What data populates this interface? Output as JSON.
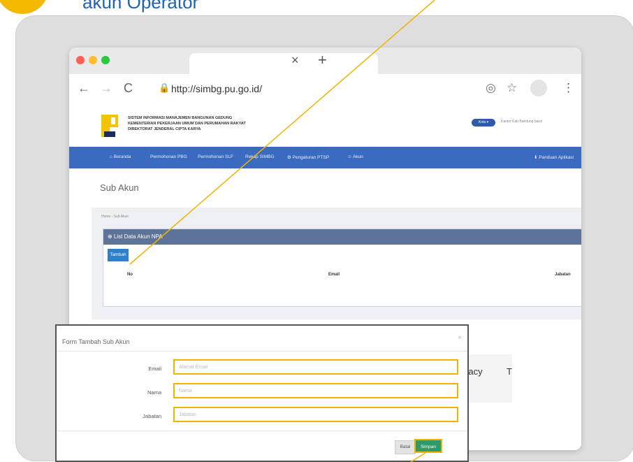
{
  "step": {
    "title": "akun Operator"
  },
  "browser": {
    "tab_close": "×",
    "new_tab": "+",
    "url": "http://simbg.pu.go.id/",
    "back_icon": "←",
    "forward_icon": "→",
    "reload_icon": "C",
    "lock_icon": "🔒",
    "menu_icon": "⋮",
    "star_icon": "☆",
    "location_icon": "◎"
  },
  "site": {
    "line1": "SISTEM INFORMASI MANAJEMEN BANGUNAN GEDUNG",
    "line2": "KEMENTERIAN PEKERJAAN UMUM DAN PERUMAHAN RAKYAT",
    "line3": "DIREKTORAT JENDERAL CIPTA KARYA",
    "kota_badge": "Kota ▾",
    "user_text": "Kantor Kab Bandung barat"
  },
  "nav": [
    {
      "label": "⌂ Beranda"
    },
    {
      "label": "Permohonan PBG"
    },
    {
      "label": "Permohonan SLF"
    },
    {
      "label": "Rekap SIMBG"
    },
    {
      "label": "⚙ Pengaturan PTSP"
    },
    {
      "label": "☺ Akun"
    },
    {
      "label": "⬇ Panduan Aplikasi"
    }
  ],
  "page": {
    "title": "Sub Akun",
    "breadcrumb": "Home › Sub Akun",
    "panel_title": "⊕ List Data Akun NPA",
    "add_button": "Tambah ✚",
    "columns": [
      "No",
      "Email",
      "Jabatan"
    ]
  },
  "footer": {
    "privacy": "Privacy",
    "terms": "T"
  },
  "modal": {
    "title": "Form Tambah Sub Akun",
    "close": "×",
    "fields": [
      {
        "label": "Email",
        "placeholder": "Alamat Email"
      },
      {
        "label": "Nama",
        "placeholder": "Nama"
      },
      {
        "label": "Jabatan",
        "placeholder": "Jabatan"
      }
    ],
    "cancel": "Batal",
    "save": "Simpan"
  },
  "colors": {
    "accent": "#f0b400",
    "brand_blue": "#3a6bc0",
    "save_green": "#2e9a68",
    "title_blue": "#1f63b4"
  }
}
